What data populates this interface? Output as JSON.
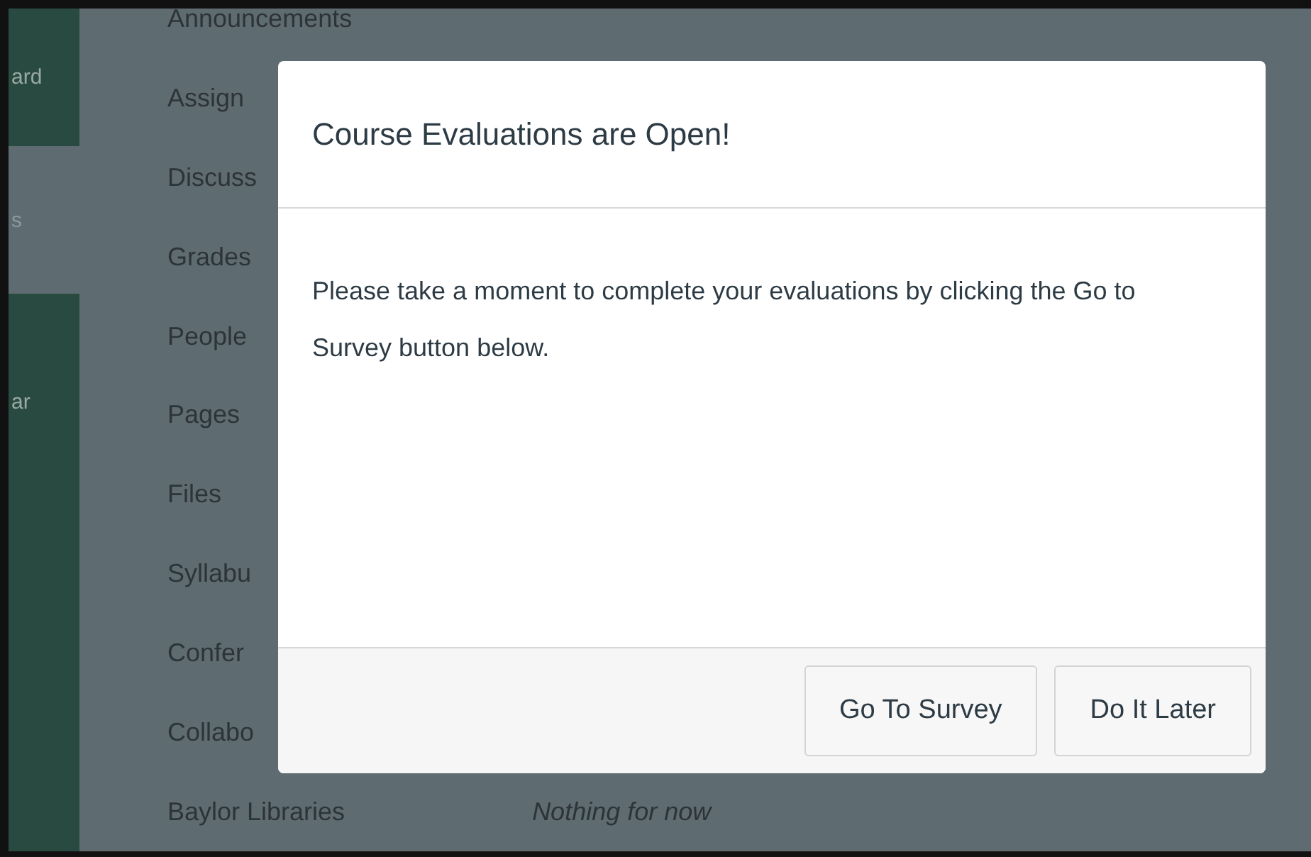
{
  "global_nav": {
    "items": [
      {
        "label": "ard",
        "selected": false
      },
      {
        "label": "s",
        "selected": true
      },
      {
        "label": "ar",
        "selected": false
      }
    ]
  },
  "course_nav": {
    "items": [
      "Announcements",
      "Assign",
      "Discuss",
      "Grades",
      "People",
      "Pages",
      "Files",
      "Syllabu",
      "Confer",
      "Collabo",
      "Baylor Libraries"
    ]
  },
  "content": {
    "status_text": "Nothing for now"
  },
  "dialog": {
    "title": "Course Evaluations are Open!",
    "message": "Please take a moment to complete your evaluations by clicking the Go to Survey button below.",
    "buttons": [
      "Go To Survey",
      "Do It Later"
    ]
  }
}
